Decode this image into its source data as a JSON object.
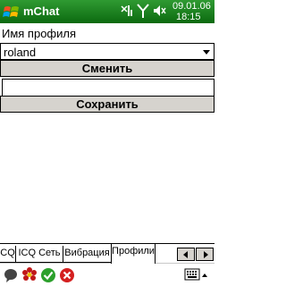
{
  "titlebar": {
    "app_title": "mChat",
    "date": "09.01.06",
    "time": "18:15",
    "color": "#0c6a10"
  },
  "profile": {
    "label": "Имя профиля",
    "selected": "roland",
    "change_button": "Сменить",
    "name_input_value": "",
    "save_button": "Сохранить"
  },
  "tabs": [
    {
      "label": "CQ"
    },
    {
      "label": "ICQ Сеть"
    },
    {
      "label": "Вибрация"
    },
    {
      "label": "Профили"
    }
  ],
  "icons": {
    "windows": "windows-start-icon",
    "signal": "signal-icon",
    "volume": "volume-icon",
    "chat": "chat-bubble-icon",
    "flower": "icq-flower-icon",
    "ok": "green-check-icon",
    "close": "red-x-icon",
    "keyboard": "keyboard-icon"
  }
}
